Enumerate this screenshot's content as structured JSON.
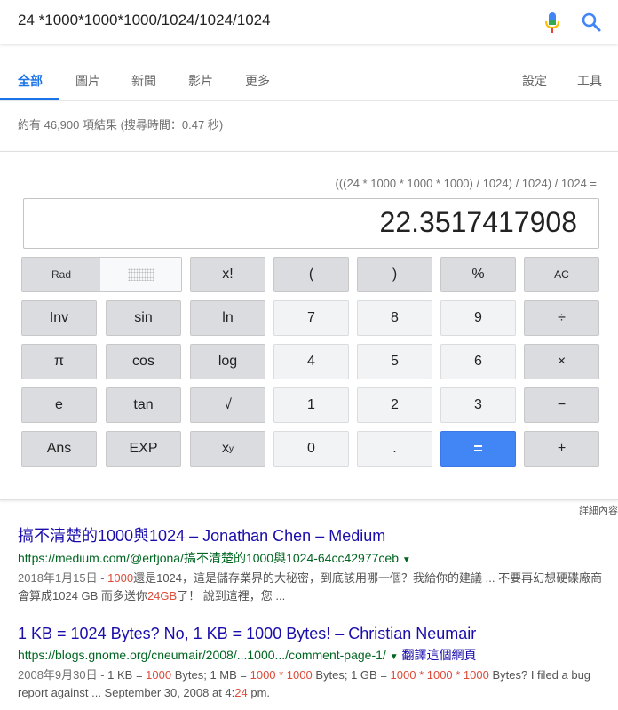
{
  "search": {
    "query": "24 *1000*1000*1000/1024/1024/1024"
  },
  "tabs": [
    "全部",
    "圖片",
    "新聞",
    "影片",
    "更多"
  ],
  "tabs_right": [
    "設定",
    "工具"
  ],
  "result_stats": "約有 46,900 項結果 (搜尋時間：0.47 秒)",
  "calculator": {
    "expression": "(((24 * 1000 * 1000 * 1000) / 1024) / 1024) / 1024 =",
    "display": "22.3517417908",
    "mode_label": "Rad",
    "keys": {
      "fact": "x!",
      "lparen": "(",
      "rparen": ")",
      "percent": "%",
      "ac": "AC",
      "inv": "Inv",
      "sin": "sin",
      "ln": "ln",
      "n7": "7",
      "n8": "8",
      "n9": "9",
      "divide": "÷",
      "pi": "π",
      "cos": "cos",
      "log": "log",
      "n4": "4",
      "n5": "5",
      "n6": "6",
      "multiply": "×",
      "e": "e",
      "tan": "tan",
      "sqrt": "√",
      "n1": "1",
      "n2": "2",
      "n3": "3",
      "minus": "−",
      "ans": "Ans",
      "exp": "EXP",
      "pow_base": "x",
      "pow_exp": "y",
      "n0": "0",
      "dot": ".",
      "equals": "=",
      "plus": "+"
    }
  },
  "details_link": "詳細內容",
  "results": [
    {
      "title": "搞不清楚的1000與1024 – Jonathan Chen – Medium",
      "url": "https://medium.com/@ertjona/搞不清楚的1000與1024-64cc42977ceb",
      "snippet_date": "2018年1月15日 - ",
      "snippet_hl1": "1000",
      "snippet_mid": "還是1024，這是儲存業界的大秘密，到底該用哪一個？我給你的建議 ... 不要再幻想硬碟廠商會算成1024 GB 而多送你",
      "snippet_hl2": "24GB",
      "snippet_end": "了！ 說到這裡，您 ..."
    },
    {
      "title": "1 KB = 1024 Bytes? No, 1 KB = 1000 Bytes! – Christian Neumair",
      "url": "https://blogs.gnome.org/cneumair/2008/...1000.../comment-page-1/",
      "translate": "翻譯這個網頁",
      "snippet_date": "2008年9月30日 - ",
      "s1": "1 KB = ",
      "h1": "1000",
      "s2": " Bytes; 1 MB = ",
      "h2": "1000 * 1000",
      "s3": " Bytes; 1 GB = ",
      "h3": "1000 * 1000 * 1000",
      "s4": " Bytes? I filed a bug report against ... September 30, 2008 at 4:",
      "h4": "24",
      "s5": " pm."
    }
  ],
  "colors": {
    "accent": "#1a73e8",
    "link": "#1a0dab",
    "url": "#006621",
    "equals": "#4285f4",
    "highlight": "#dd4b39"
  }
}
